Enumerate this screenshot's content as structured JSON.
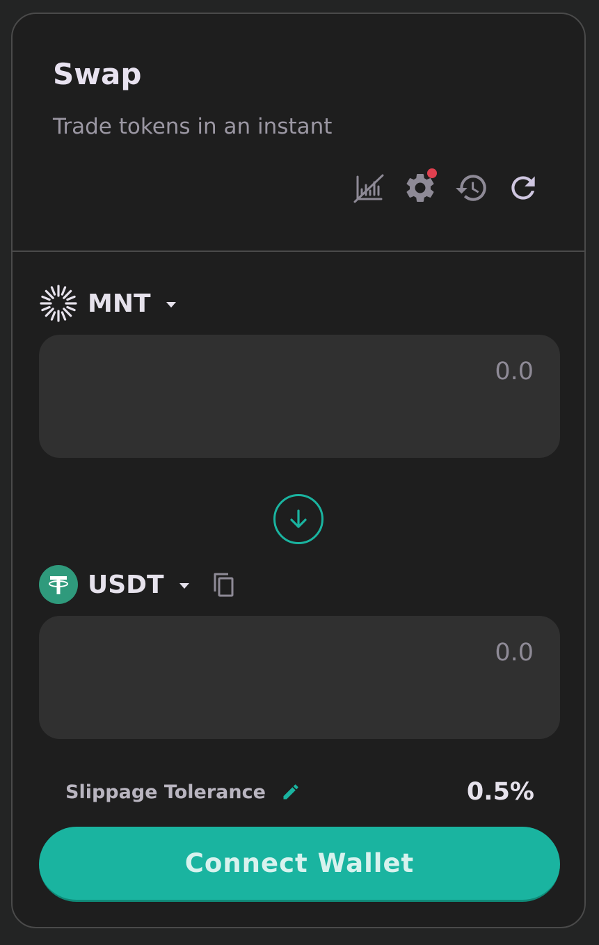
{
  "header": {
    "title": "Swap",
    "subtitle": "Trade tokens in an instant"
  },
  "toolbar": {
    "icons": [
      "chart-disabled-icon",
      "settings-icon",
      "history-icon",
      "refresh-icon"
    ],
    "settings_has_notification": true
  },
  "from": {
    "symbol": "MNT",
    "icon": "mnt-token-icon",
    "placeholder": "0.0",
    "value": ""
  },
  "to": {
    "symbol": "USDT",
    "icon": "usdt-token-icon",
    "placeholder": "0.0",
    "value": ""
  },
  "slippage": {
    "label": "Slippage Tolerance",
    "value": "0.5%"
  },
  "connect_label": "Connect Wallet",
  "colors": {
    "accent": "#1ab4a0",
    "background": "#1e1e1e",
    "input_bg": "#303030",
    "notification": "#e0404f",
    "usdt": "#2f9a7c"
  }
}
